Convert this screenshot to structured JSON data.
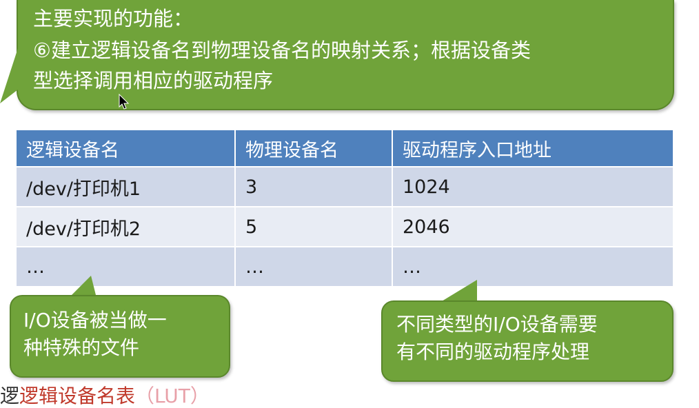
{
  "top_callout": {
    "line1": "主要实现的功能：",
    "line2": "⑥建立逻辑设备名到物理设备名的映射关系；根据设备类",
    "line3": "型选择调用相应的驱动程序"
  },
  "table": {
    "headers": [
      "逻辑设备名",
      "物理设备名",
      "驱动程序入口地址"
    ],
    "rows": [
      [
        "/dev/打印机1",
        "3",
        "1024"
      ],
      [
        "/dev/打印机2",
        "5",
        "2046"
      ],
      [
        "…",
        "…",
        "…"
      ]
    ]
  },
  "left_callout": {
    "line1": "I/O设备被当做一",
    "line2": "种特殊的文件"
  },
  "right_callout": {
    "line1": "不同类型的I/O设备需要",
    "line2": "有不同的驱动程序处理"
  },
  "bottom": {
    "prefix": "逻",
    "highlight": "逻辑设备名表",
    "suffix": "（LUT）"
  },
  "colors": {
    "callout_green": "#70a33a",
    "table_header_blue": "#4f81bd",
    "row_light": "#e8ecf4",
    "row_dark": "#cfd7e8",
    "highlight_red": "#c0392b"
  },
  "icons": [
    "mouse-pointer-icon"
  ]
}
